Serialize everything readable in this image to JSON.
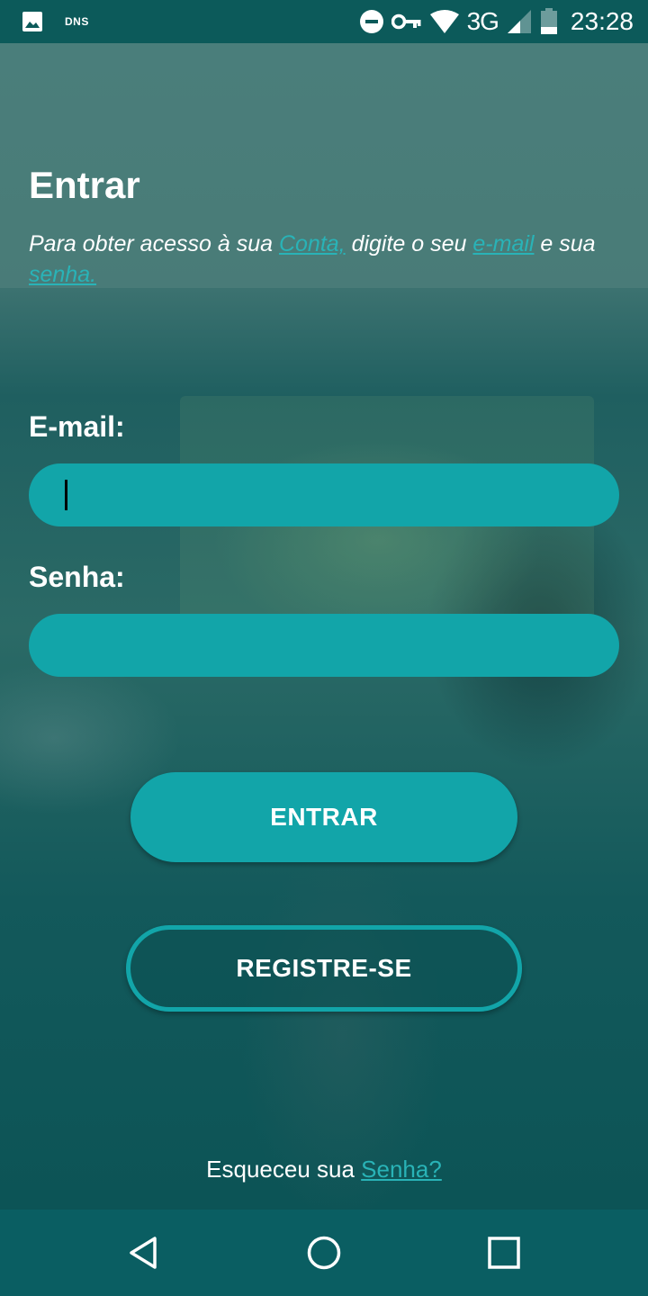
{
  "status_bar": {
    "left_icons": [
      "image-icon"
    ],
    "dns_label": "DNS",
    "right_icons": [
      "do-not-disturb-icon",
      "vpn-key-icon",
      "wifi-icon",
      "signal-icon",
      "battery-icon"
    ],
    "network": "3G",
    "time": "23:28"
  },
  "login": {
    "title": "Entrar",
    "desc": {
      "part1": "Para obter acesso à sua ",
      "link_account": "Conta,",
      "part2": " digite o seu ",
      "link_email": "e-mail",
      "part3": " e sua ",
      "link_password": "senha."
    },
    "email_label": "E-mail:",
    "email_value": "",
    "password_label": "Senha:",
    "password_value": "",
    "submit_label": "ENTRAR",
    "register_label": "REGISTRE-SE",
    "forgot_text": "Esqueceu sua ",
    "forgot_link": "Senha?"
  },
  "colors": {
    "accent": "#12a5a9",
    "link": "#29b3b7",
    "status_bar": "#0c5a5a",
    "nav_bar": "#0a5e62"
  },
  "nav": {
    "icons": [
      "back-icon",
      "home-icon",
      "recents-icon"
    ]
  }
}
